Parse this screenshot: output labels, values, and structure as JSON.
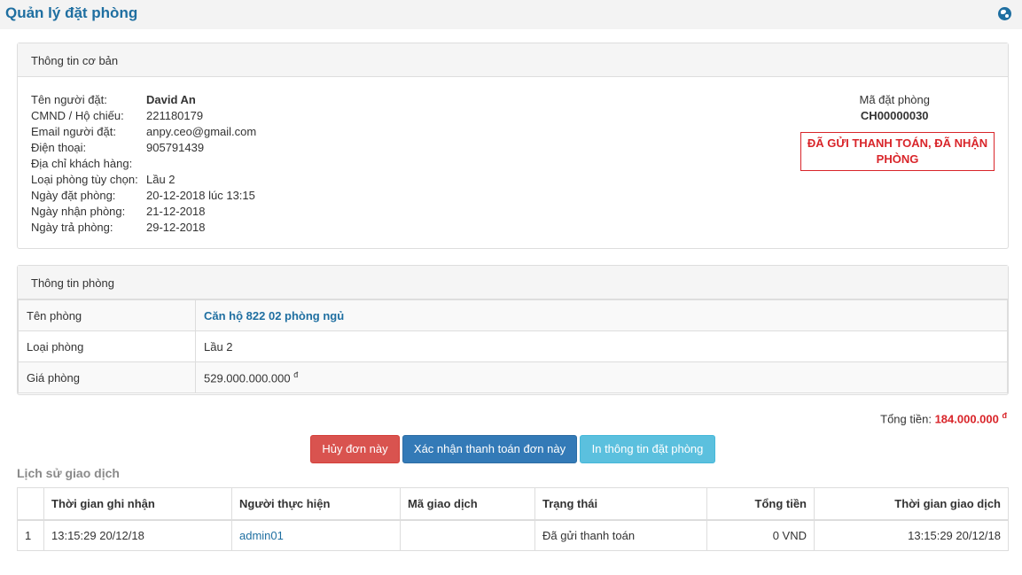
{
  "header": {
    "title": "Quản lý đặt phòng",
    "icon": "globe-icon"
  },
  "basic_info": {
    "heading": "Thông tin cơ bản",
    "rows": [
      {
        "label": "Tên người đặt:",
        "value": "David An"
      },
      {
        "label": "CMND / Hộ chiếu:",
        "value": "221180179"
      },
      {
        "label": "Email người đặt:",
        "value": "anpy.ceo@gmail.com"
      },
      {
        "label": "Điện thoại:",
        "value": "905791439"
      },
      {
        "label": "Địa chỉ khách hàng:",
        "value": ""
      },
      {
        "label": "Loại phòng tùy chọn:",
        "value": "Lầu 2"
      },
      {
        "label": "Ngày đặt phòng:",
        "value": "20-12-2018 lúc 13:15"
      },
      {
        "label": "Ngày nhận phòng:",
        "value": "21-12-2018"
      },
      {
        "label": "Ngày trả phòng:",
        "value": "29-12-2018"
      }
    ],
    "code_label": "Mã đặt phòng",
    "code_value": "CH00000030",
    "status_line1": "ĐÃ GỬI THANH TOÁN, ĐÃ NHẬN",
    "status_line2": "PHÒNG"
  },
  "room_info": {
    "heading": "Thông tin phòng",
    "name_label": "Tên phòng",
    "name_value": "Căn hộ 822 02 phòng ngủ",
    "type_label": "Loại phòng",
    "type_value": "Lầu 2",
    "price_label": "Giá phòng",
    "price_value": "529.000.000.000",
    "price_currency": "đ"
  },
  "total": {
    "label": "Tổng tiền:",
    "value": "184.000.000",
    "currency": "đ"
  },
  "actions": {
    "cancel": "Hủy đơn này",
    "confirm": "Xác nhận thanh toán đơn này",
    "print": "In thông tin đặt phòng"
  },
  "history": {
    "title": "Lịch sử giao dịch",
    "headers": [
      "",
      "Thời gian ghi nhận",
      "Người thực hiện",
      "Mã giao dịch",
      "Trạng thái",
      "Tổng tiền",
      "Thời gian giao dịch"
    ],
    "rows": [
      {
        "index": "1",
        "recorded": "13:15:29 20/12/18",
        "user": "admin01",
        "code": "",
        "status": "Đã gửi thanh toán",
        "amount": "0 VND",
        "time": "13:15:29 20/12/18"
      }
    ]
  },
  "colors": {
    "accent": "#1f6fa1",
    "danger": "#d9252a",
    "primary": "#337ab7",
    "info": "#5bc0de",
    "btn_danger": "#d9534f"
  }
}
